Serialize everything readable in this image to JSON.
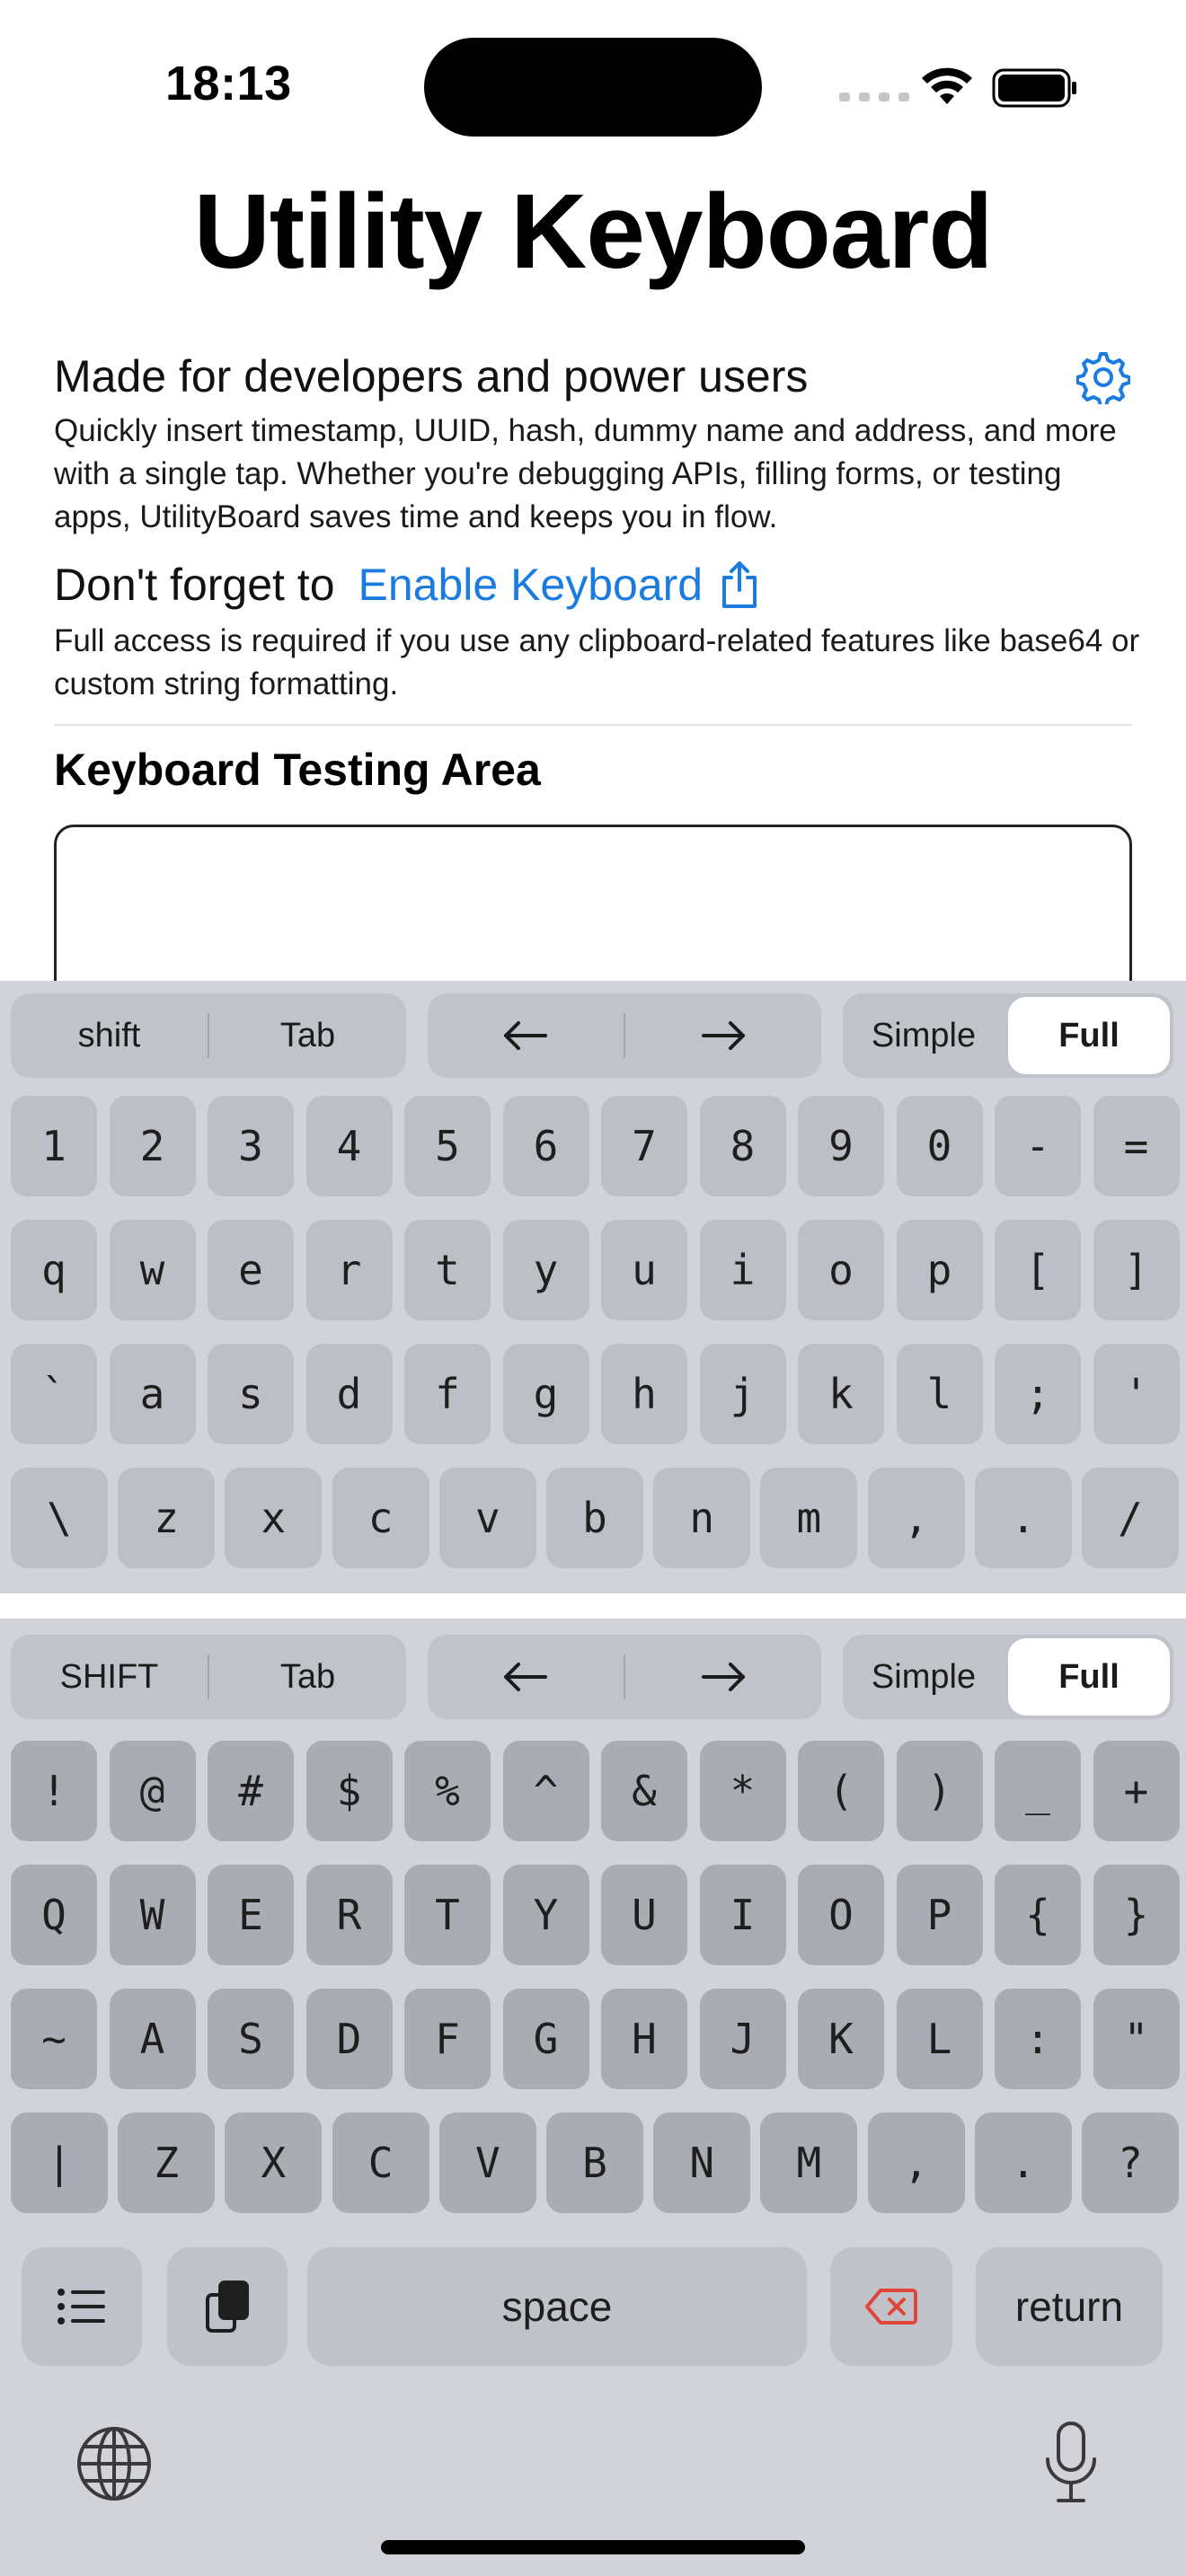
{
  "status": {
    "time": "18:13"
  },
  "app": {
    "title": "Utility Keyboard",
    "section_heading": "Made for developers and power users",
    "description": "Quickly insert timestamp, UUID, hash, dummy name and address, and more with a single tap. Whether you're debugging APIs, filling forms, or testing apps, UtilityBoard saves time and keeps you in flow.",
    "forget_label": "Don't forget to",
    "enable_link": "Enable Keyboard",
    "note": "Full access is required if you use any clipboard-related features like base64 or custom string formatting.",
    "testing_title": "Keyboard Testing Area",
    "link_color": "#1a7be0"
  },
  "keyboard_lower": {
    "toolbar": {
      "shift": "shift",
      "tab": "Tab",
      "mode_simple": "Simple",
      "mode_full": "Full",
      "selected_mode": "Full"
    },
    "rows": [
      [
        "1",
        "2",
        "3",
        "4",
        "5",
        "6",
        "7",
        "8",
        "9",
        "0",
        "-",
        "="
      ],
      [
        "q",
        "w",
        "e",
        "r",
        "t",
        "y",
        "u",
        "i",
        "o",
        "p",
        "[",
        "]"
      ],
      [
        "`",
        "a",
        "s",
        "d",
        "f",
        "g",
        "h",
        "j",
        "k",
        "l",
        ";",
        "'"
      ],
      [
        "\\",
        "z",
        "x",
        "c",
        "v",
        "b",
        "n",
        "m",
        ",",
        ".",
        "/"
      ]
    ]
  },
  "keyboard_upper": {
    "toolbar": {
      "shift": "SHIFT",
      "tab": "Tab",
      "mode_simple": "Simple",
      "mode_full": "Full",
      "selected_mode": "Full"
    },
    "rows": [
      [
        "!",
        "@",
        "#",
        "$",
        "%",
        "^",
        "&",
        "*",
        "(",
        ")",
        "_",
        "+"
      ],
      [
        "Q",
        "W",
        "E",
        "R",
        "T",
        "Y",
        "U",
        "I",
        "O",
        "P",
        "{",
        "}"
      ],
      [
        "~",
        "A",
        "S",
        "D",
        "F",
        "G",
        "H",
        "J",
        "K",
        "L",
        ":",
        "\""
      ],
      [
        "|",
        "Z",
        "X",
        "C",
        "V",
        "B",
        "N",
        "M",
        ",",
        ".",
        "?"
      ]
    ],
    "space_label": "space",
    "return_label": "return",
    "delete_color": "#e0443a"
  }
}
